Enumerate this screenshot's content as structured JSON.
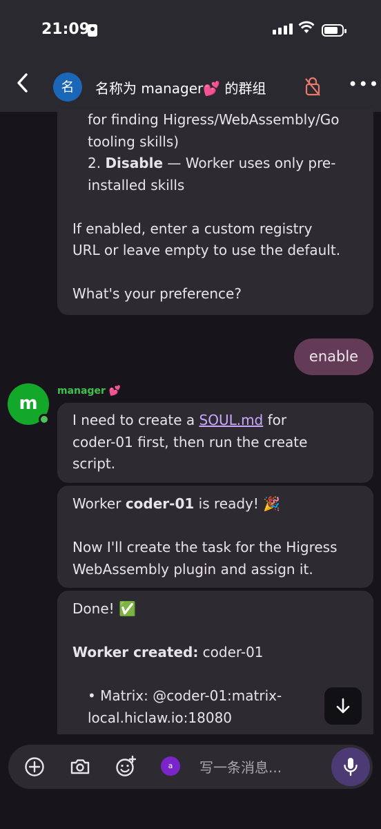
{
  "status_bar": {
    "time": "21:09"
  },
  "header": {
    "back_icon": "chevron-left-icon",
    "avatar_letter": "名",
    "title": "名称为 manager💕 的群组",
    "more_label": "•••"
  },
  "messages": {
    "partial": {
      "line1": "for finding Higress/WebAssembly/Go",
      "line2": "tooling skills)",
      "opt2_num": "2. ",
      "opt2_bold": "Disable",
      "opt2_rest1": " — Worker uses only pre-",
      "opt2_rest2": "installed skills",
      "para1_line1": "If enabled, enter a custom registry",
      "para1_line2": "URL or leave empty to use the default.",
      "para2": "What's your preference?"
    },
    "user_reply": "enable",
    "sender": {
      "name": "manager",
      "emoji": "💕",
      "avatar_letter": "m",
      "online_color": "#4fc15a"
    },
    "msg1": {
      "pre": "I need to create a ",
      "link": "SOUL.md",
      "post1": " for",
      "line2": "coder-01 first, then run the create",
      "line3": "script."
    },
    "msg2": {
      "pre": "Worker ",
      "bold": "coder-01",
      "post": " is ready! 🎉",
      "line2": "Now I'll create the task for the Higress",
      "line3": "WebAssembly plugin and assign it."
    },
    "msg3": {
      "line1": "Done! ✅",
      "bold": "Worker created:",
      "rest": " coder-01",
      "bullet1": "• Matrix: @coder-01:matrix-",
      "bullet2": "local.hiclaw.io:18080"
    }
  },
  "scroll_button": "↓",
  "composer": {
    "placeholder": "写一条消息...",
    "account_letter": "a"
  },
  "colors": {
    "accent": "#633b57",
    "link": "#c9a8ff",
    "sender_name": "#3ec24d",
    "mic_button": "#4c3a75"
  }
}
